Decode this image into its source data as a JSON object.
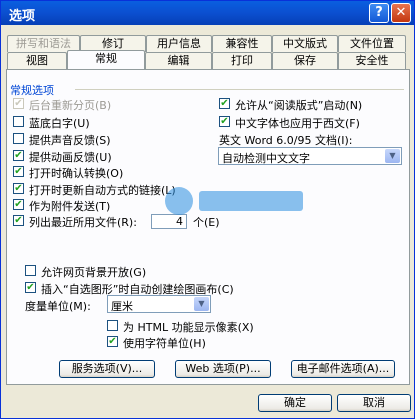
{
  "window": {
    "title": "选项",
    "help_label": "?",
    "close_label": "✕"
  },
  "tabs_row1": [
    {
      "label": "拼写和语法",
      "disabled": true
    },
    {
      "label": "修订"
    },
    {
      "label": "用户信息"
    },
    {
      "label": "兼容性"
    },
    {
      "label": "中文版式"
    },
    {
      "label": "文件位置"
    }
  ],
  "tabs_row2": [
    {
      "label": "视图"
    },
    {
      "label": "常规",
      "active": true
    },
    {
      "label": "编辑"
    },
    {
      "label": "打印"
    },
    {
      "label": "保存"
    },
    {
      "label": "安全性"
    }
  ],
  "general": {
    "section_title": "常规选项",
    "left_options": [
      {
        "label": "后台重新分页(B)",
        "checked": true,
        "disabled": true
      },
      {
        "label": "蓝底白字(U)",
        "checked": false
      },
      {
        "label": "提供声音反馈(S)",
        "checked": false
      },
      {
        "label": "提供动画反馈(U)",
        "checked": true
      },
      {
        "label": "打开时确认转换(O)",
        "checked": true
      },
      {
        "label": "打开时更新自动方式的链接(L)",
        "checked": true
      },
      {
        "label": "作为附件发送(T)",
        "checked": true
      },
      {
        "label": "列出最近所用文件(R):",
        "checked": true
      }
    ],
    "right_options": [
      {
        "label": "允许从“阅读版式”启动(N)",
        "checked": true
      },
      {
        "label": "中文字体也应用于西文(F)",
        "checked": true
      }
    ],
    "word_doc_label": "英文 Word 6.0/95 文档(I):",
    "word_doc_value": "自动检测中文文字",
    "recent_files_count": "4",
    "recent_files_unit": "个(E)",
    "bottom_options": [
      {
        "label": "允许网页背景开放(G)",
        "checked": false
      },
      {
        "label": "插入“自选图形”时自动创建绘图画布(C)",
        "checked": true
      }
    ],
    "unit_label": "度量单位(M):",
    "unit_value": "厘米",
    "html_pixels": {
      "label": "为 HTML 功能显示像素(X)",
      "checked": false
    },
    "char_units": {
      "label": "使用字符单位(H)",
      "checked": true
    },
    "service_button": "服务选项(V)...",
    "web_button": "Web 选项(P)...",
    "email_button": "电子邮件选项(A)..."
  },
  "footer": {
    "ok": "确定",
    "cancel": "取消"
  },
  "colors": {
    "title_bar": "#0b4fd0",
    "section_title": "#0046d5",
    "check_mark": "#21a121"
  },
  "icons": {
    "checked": "check-mark-icon",
    "dropdown": "chevron-down-icon",
    "help": "help-icon",
    "close": "close-icon"
  }
}
